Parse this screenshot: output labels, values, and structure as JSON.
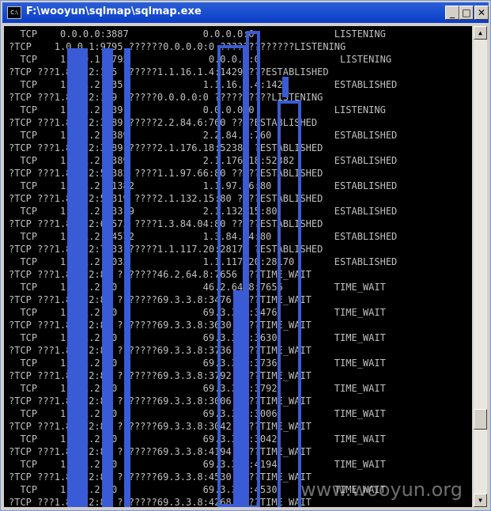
{
  "window": {
    "title": "F:\\wooyun\\sqlmap\\sqlmap.exe",
    "icon_label": "C:\\",
    "buttons": {
      "minimize": "_",
      "maximize": "□",
      "close": "✕"
    }
  },
  "console": {
    "lines": [
      "  TCP    0.0.0.0:3887             0.0.0.0:0              LISTENING",
      "?TCP    1.0.0.1:9795 ??????0.0.0.0:0 ?????????????LISTENING",
      "  TCP    1.0.0.1:9795              0.0.0.0:0              LISTENING",
      "?TCP ???1.8.1.2:135 ??????1.1.16.1.4:1429 ???ESTABLISHED",
      "  TCP    1.8.1.2:135              1.1.16.1.4:1429        ESTABLISHED",
      "?TCP ???1.8.1.2:139 ??????0.0.0.0:0 ??????????LISTENING",
      "  TCP    1.8.1.2:139              0.0.0.0:0              LISTENING",
      "?TCP ???1.8.1.2:3389 ?????2.2.84.6:760 ????ESTABLISHED",
      "  TCP    1.8.1.2:3389             2.2.84.6:760           ESTABLISHED",
      "?TCP ???1.8.1.2:3389 ?????2.1.176.18:52382 ?ESTABLISHED",
      "  TCP    1.8.1.2:3389             2.1.176.18:52382       ESTABLISHED",
      "?TCP ???1.8.1.2:51382 ????1.1.97.66:80 ?????ESTABLISHED",
      "  TCP    1.8.1.2:51382            1.1.97.66:80           ESTABLISHED",
      "?TCP ???1.8.1.2:53319 ????2.1.132.15:80 ????ESTABLISHED",
      "  TCP    1.8.1.2:53319            2.1.132.15:80          ESTABLISHED",
      "?TCP ???1.8.1.2:64572 ????1.3.84.04:80 ?????ESTABLISHED",
      "  TCP    1.8.1.2:64572            1.3.84.04:80           ESTABLISHED",
      "?TCP ???1.8.1.2:7033 ?????1.1.117.20:28170 ?ESTABLISHED",
      "  TCP    1.8.1.2:7033             1.1.117.20:28170       ESTABLISHED",
      "?TCP ???1.8.1.2:80 ???????46.2.64.8:7656 ???TIME_WAIT",
      "  TCP    1.8.1.2:80               46.2.64.8:7656         TIME_WAIT",
      "?TCP ???1.8.1.2:80 ???????69.3.3.8:3476 ????TIME_WAIT",
      "  TCP    1.8.1.2:80               69.3.3.8:3476          TIME_WAIT",
      "?TCP ???1.8.1.2:80 ???????69.3.3.8:3630 ????TIME_WAIT",
      "  TCP    1.8.1.2:80               69.3.3.8:3630          TIME_WAIT",
      "?TCP ???1.8.1.2:80 ???????69.3.3.8:3736 ????TIME_WAIT",
      "  TCP    1.8.1.2:80               69.3.3.8:3736          TIME_WAIT",
      "?TCP ???1.8.1.2:80 ???????69.3.3.8:3792 ????TIME_WAIT",
      "  TCP    1.8.1.2:80               69.3.3.8:3792          TIME_WAIT",
      "?TCP ???1.8.1.2:80 ???????69.3.3.8:3006 ????TIME_WAIT",
      "  TCP    1.8.1.2:80               69.3.3.8:3006          TIME_WAIT",
      "?TCP ???1.8.1.2:80 ???????69.3.3.8:3042 ????TIME_WAIT",
      "  TCP    1.8.1.2:80               69.3.3.8:3042          TIME_WAIT",
      "?TCP ???1.8.1.2:80 ???????69.3.3.8:4194 ????TIME_WAIT",
      "  TCP    1.8.1.2:80               69.3.3.8:4194          TIME_WAIT",
      "?TCP ???1.8.1.2:80 ???????69.3.3.8:4530 ????TIME_WAIT",
      "  TCP    1.8.1.2:80               69.3.3.8:4530          TIME_WAIT",
      "?TCP ???1.8.1.2:80 ???????69.3.3.8:4268 ????TIME_WAIT"
    ]
  },
  "watermark": "www.wooyun.org",
  "colors": {
    "titlebar": "#0a3dc7",
    "console_bg": "#000000",
    "console_text": "#c0c0c0",
    "redaction": "#3a5bd6"
  }
}
